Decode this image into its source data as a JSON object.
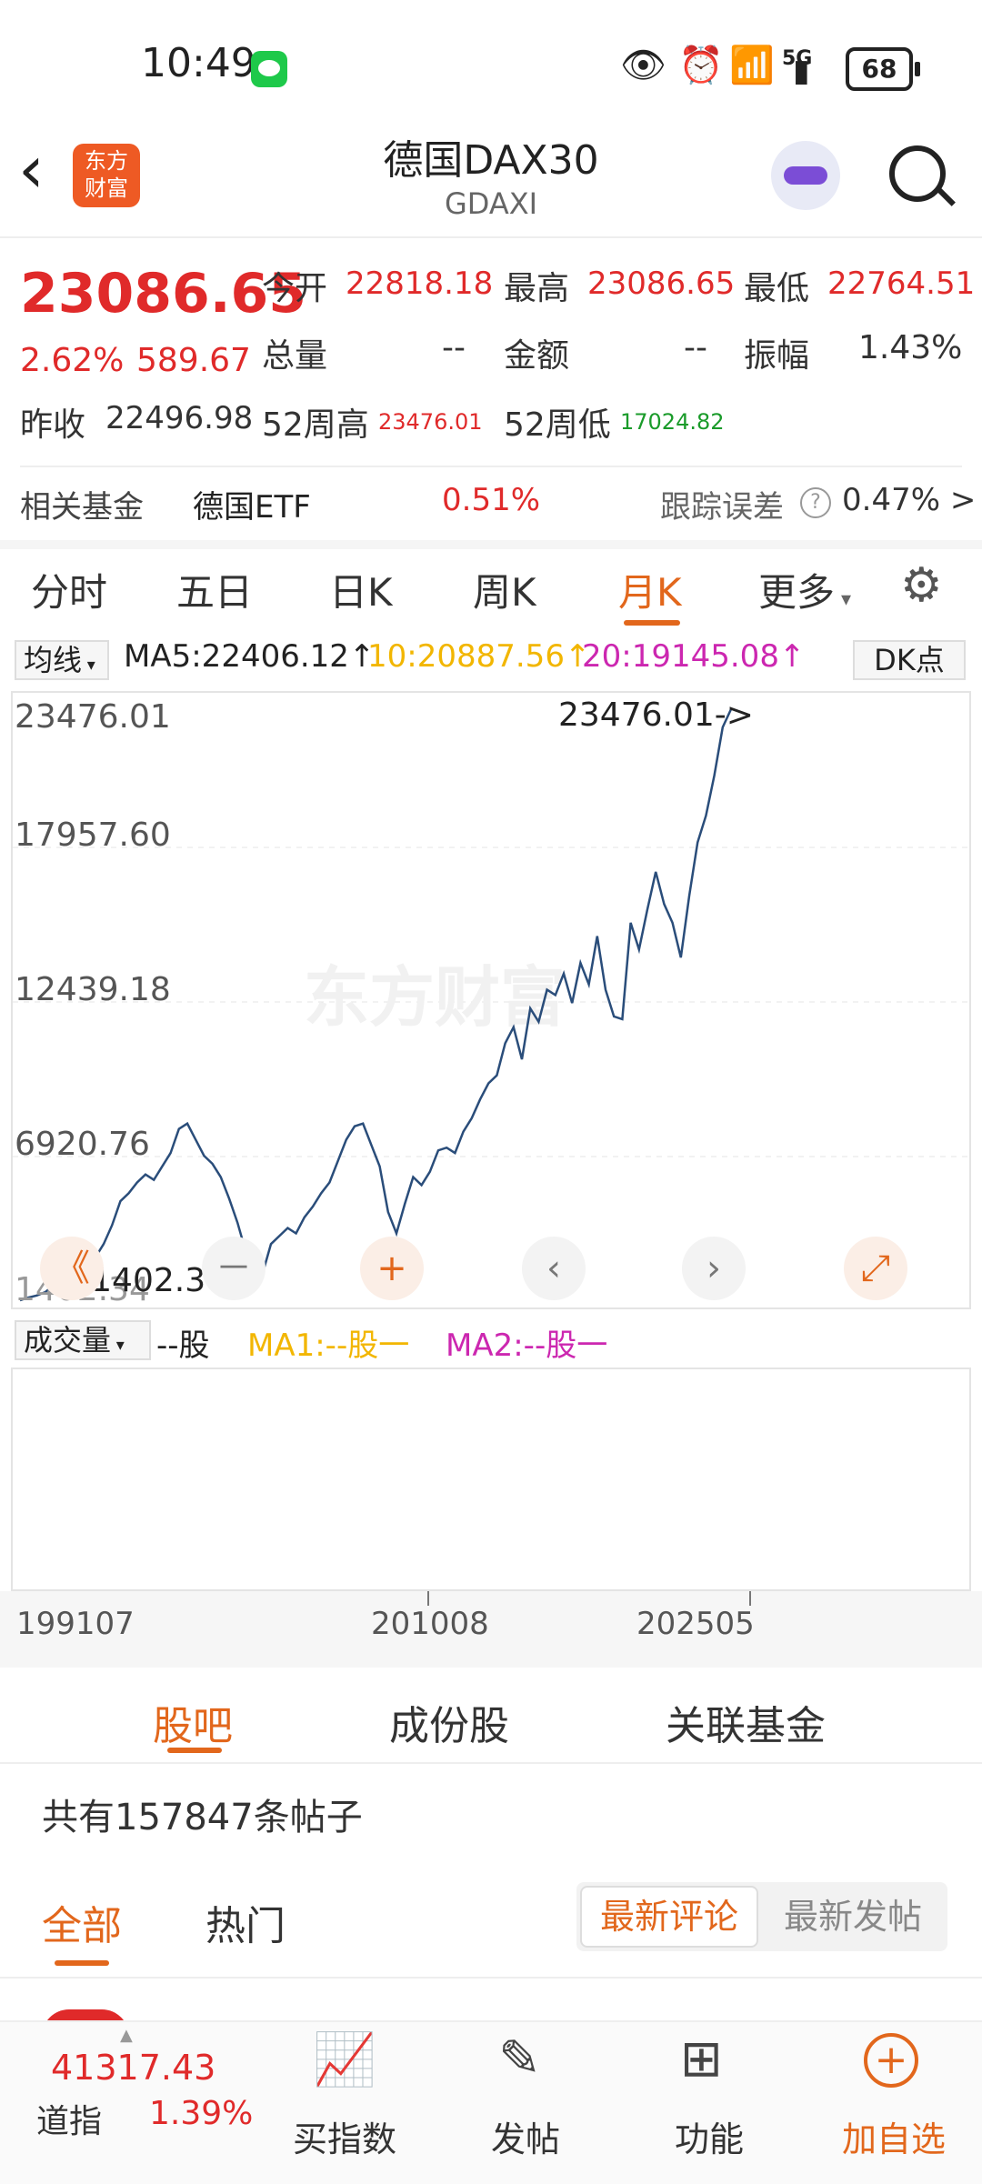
{
  "status_bar": {
    "time": "10:49",
    "battery": "68",
    "network": "5G"
  },
  "header": {
    "title": "德国DAX30",
    "code": "GDAXI",
    "logo_text_1": "东方",
    "logo_text_2": "财富"
  },
  "quote": {
    "price": "23086.65",
    "pct": "2.62%",
    "change": "589.67",
    "open_label": "今开",
    "open": "22818.18",
    "high_label": "最高",
    "high": "23086.65",
    "low_label": "最低",
    "low": "22764.51",
    "volume_label": "总量",
    "volume": "--",
    "amount_label": "金额",
    "amount": "--",
    "amplitude_label": "振幅",
    "amplitude": "1.43%",
    "prev_close_label": "昨收",
    "prev_close": "22496.98",
    "w52_high_label": "52周高",
    "w52_high": "23476.01",
    "w52_low_label": "52周低",
    "w52_low": "17024.82"
  },
  "fund_row": {
    "label": "相关基金",
    "fund": "德国ETF",
    "fund_pct": "0.51%",
    "tracking_label": "跟踪误差",
    "tracking_value": "0.47% >"
  },
  "tabs": [
    "分时",
    "五日",
    "日K",
    "周K",
    "月K",
    "更多"
  ],
  "active_tab": "月K",
  "ma": {
    "selector": "均线",
    "ma5": "MA5:22406.12↑",
    "ma10": "10:20887.56↑",
    "ma20": "20:19145.08↑",
    "dk": "DK点"
  },
  "chart_data": {
    "type": "line",
    "x_start": "199107",
    "x_ticks": [
      "199107",
      "201008",
      "202505"
    ],
    "y_ticks": [
      "23476.01",
      "17957.60",
      "12439.18",
      "6920.76",
      "1402.34"
    ],
    "ylim": [
      1402.34,
      23476.01
    ],
    "max_annotation": "23476.01->",
    "min_annotation": "<--1402.34",
    "watermark": "东方财富",
    "y": [
      1402,
      1500,
      1580,
      1700,
      1950,
      2200,
      2400,
      2300,
      2500,
      3000,
      3500,
      4200,
      5100,
      5400,
      5800,
      6100,
      5900,
      6400,
      6900,
      7800,
      8000,
      7400,
      6800,
      6500,
      6000,
      5200,
      4300,
      3200,
      2800,
      2400,
      3500,
      3800,
      4100,
      3900,
      4500,
      4900,
      5400,
      5800,
      6600,
      7400,
      7900,
      8000,
      7200,
      6400,
      4700,
      3900,
      5000,
      6000,
      5700,
      6200,
      7000,
      7100,
      6900,
      7700,
      8200,
      8900,
      9500,
      9800,
      11000,
      11600,
      10400,
      12300,
      11800,
      13000,
      12800,
      13600,
      12500,
      14000,
      13200,
      15000,
      13000,
      12000,
      11900,
      15500,
      14500,
      16000,
      17400,
      16200,
      15500,
      14200,
      16500,
      18500,
      19500,
      21000,
      22800,
      23476
    ],
    "volume_ma": {
      "selector": "成交量",
      "unit": "--股",
      "ma1": "MA1:--股一",
      "ma2": "MA2:--股一"
    }
  },
  "controls": [
    "《",
    "‹",
    "+",
    "‹",
    "›",
    "⤢"
  ],
  "bottom_tabs": [
    "股吧",
    "成份股",
    "关联基金"
  ],
  "posts_count_text": "共有157847条帖子",
  "filters": {
    "all": "全部",
    "hot": "热门",
    "latest_comment": "最新评论",
    "latest_post": "最新发帖"
  },
  "bottom_bar": {
    "index_value": "41317.43",
    "index_name": "道指",
    "index_pct": "1.39%",
    "buy_index": "买指数",
    "post": "发帖",
    "functions": "功能",
    "add_watch": "加自选"
  }
}
